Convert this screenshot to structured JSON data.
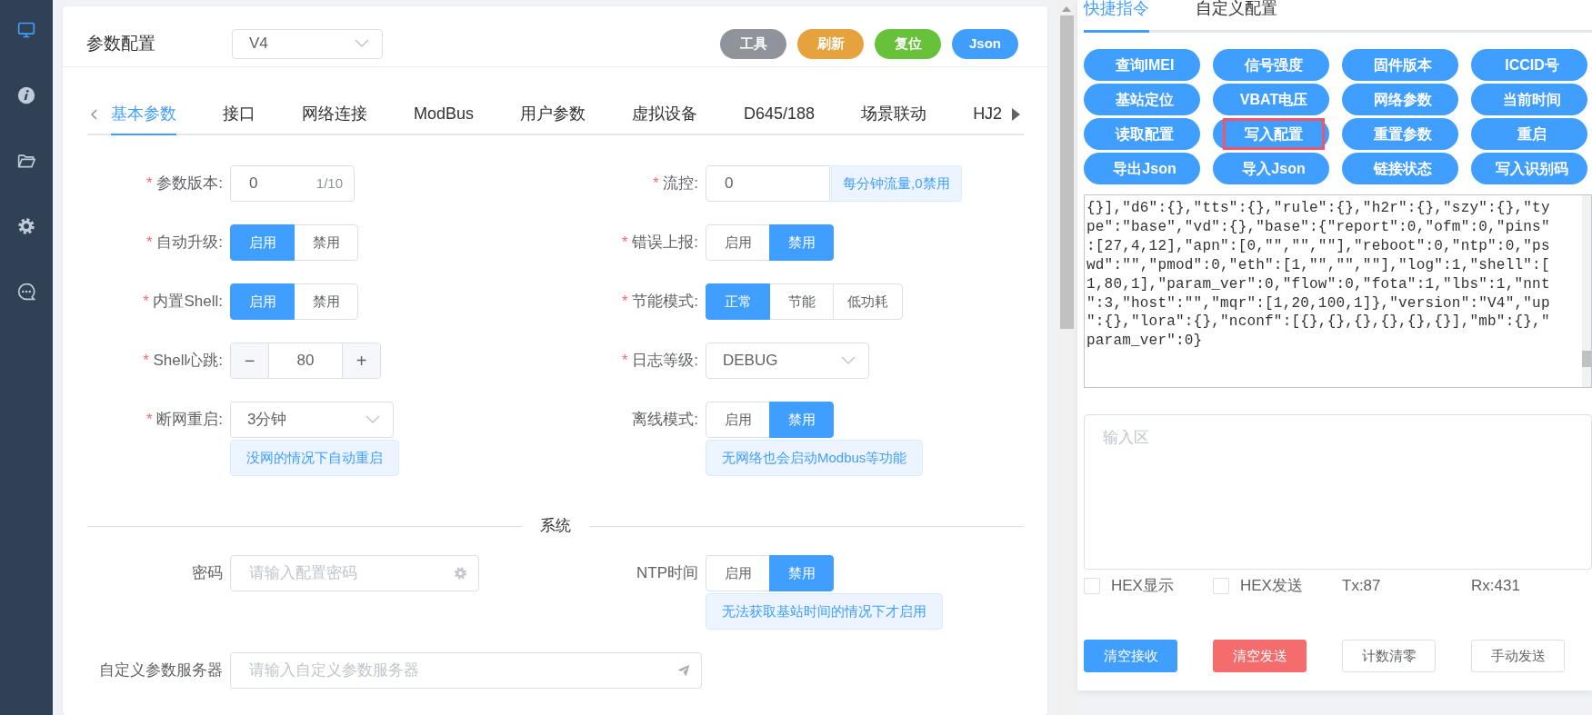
{
  "sidebar": {
    "items": [
      {
        "kind": "monitor",
        "selected": true
      },
      {
        "kind": "info",
        "selected": false
      },
      {
        "kind": "folder",
        "selected": false
      },
      {
        "kind": "gear",
        "selected": false
      },
      {
        "kind": "chat",
        "selected": false
      }
    ]
  },
  "header": {
    "title": "参数配置",
    "version": "V4",
    "buttons": [
      {
        "label": "工具",
        "color": "#909399"
      },
      {
        "label": "刷新",
        "color": "#e6a23c"
      },
      {
        "label": "复位",
        "color": "#67c23a"
      },
      {
        "label": "Json",
        "color": "#409eff"
      }
    ]
  },
  "tabs": [
    {
      "label": "基本参数",
      "selected": true
    },
    {
      "label": "接口",
      "selected": false
    },
    {
      "label": "网络连接",
      "selected": false
    },
    {
      "label": "ModBus",
      "selected": false
    },
    {
      "label": "用户参数",
      "selected": false
    },
    {
      "label": "虚拟设备",
      "selected": false
    },
    {
      "label": "D645/188",
      "selected": false
    },
    {
      "label": "场景联动",
      "selected": false
    },
    {
      "label": "HJ2",
      "selected": false
    }
  ],
  "basic_fields": [
    {
      "label": "参数版本:",
      "required_mark": "*",
      "kind": "input",
      "value": "0",
      "counter": "1/10"
    },
    {
      "label": "流控:",
      "required_mark": "*",
      "kind": "input",
      "value": "0",
      "addon": "每分钟流量,0禁用"
    },
    {
      "label": "自动升级:",
      "required_mark": "*",
      "kind": "toggle",
      "options": [
        {
          "label": "启用",
          "selected": true
        },
        {
          "label": "禁用",
          "selected": false
        }
      ]
    },
    {
      "label": "错误上报:",
      "required_mark": "*",
      "kind": "toggle",
      "options": [
        {
          "label": "启用",
          "selected": false
        },
        {
          "label": "禁用",
          "selected": true
        }
      ]
    },
    {
      "label": "内置Shell:",
      "required_mark": "*",
      "kind": "toggle",
      "options": [
        {
          "label": "启用",
          "selected": true
        },
        {
          "label": "禁用",
          "selected": false
        }
      ]
    },
    {
      "label": "节能模式:",
      "required_mark": "*",
      "kind": "toggle",
      "options": [
        {
          "label": "正常",
          "selected": true
        },
        {
          "label": "节能",
          "selected": false
        },
        {
          "label": "低功耗",
          "selected": false
        }
      ]
    },
    {
      "label": "Shell心跳:",
      "required_mark": "*",
      "kind": "stepper",
      "value": "80",
      "minus": "−",
      "plus": "+"
    },
    {
      "label": "日志等级:",
      "required_mark": "*",
      "kind": "select",
      "value": "DEBUG"
    },
    {
      "label": "断网重启:",
      "required_mark": "*",
      "kind": "select",
      "value": "3分钟",
      "hint": "没网的情况下自动重启"
    },
    {
      "label": "离线模式:",
      "kind": "toggle",
      "options": [
        {
          "label": "启用",
          "selected": false
        },
        {
          "label": "禁用",
          "selected": true
        }
      ],
      "hint": "无网络也会启动Modbus等功能"
    }
  ],
  "system": {
    "title": "系统",
    "fields": [
      {
        "label": "密码",
        "kind": "password_input",
        "placeholder": "请输入配置密码"
      },
      {
        "label": "NTP时间",
        "kind": "toggle",
        "options": [
          {
            "label": "启用",
            "selected": false
          },
          {
            "label": "禁用",
            "selected": true
          }
        ],
        "hint": "无法获取基站时间的情况下才启用"
      },
      {
        "label": "自定义参数服务器",
        "kind": "server_input",
        "placeholder": "请输入自定义参数服务器"
      }
    ]
  },
  "console": {
    "tabs": [
      {
        "label": "快捷指令",
        "selected": true
      },
      {
        "label": "自定义配置",
        "selected": false
      }
    ],
    "commands": [
      {
        "label": "查询IMEI",
        "highlighted": false
      },
      {
        "label": "信号强度",
        "highlighted": false
      },
      {
        "label": "固件版本",
        "highlighted": false
      },
      {
        "label": "ICCID号",
        "highlighted": false
      },
      {
        "label": "基站定位",
        "highlighted": false
      },
      {
        "label": "VBAT电压",
        "highlighted": false
      },
      {
        "label": "网络参数",
        "highlighted": false
      },
      {
        "label": "当前时间",
        "highlighted": false
      },
      {
        "label": "读取配置",
        "highlighted": false
      },
      {
        "label": "写入配置",
        "highlighted": true
      },
      {
        "label": "重置参数",
        "highlighted": false
      },
      {
        "label": "重启",
        "highlighted": false
      },
      {
        "label": "导出Json",
        "highlighted": false
      },
      {
        "label": "导入Json",
        "highlighted": false
      },
      {
        "label": "链接状态",
        "highlighted": false
      },
      {
        "label": "写入识别码",
        "highlighted": false
      }
    ],
    "received": "{}],\"d6\":{},\"tts\":{},\"rule\":{},\"h2r\":{},\"szy\":{},\"type\":\"base\",\"vd\":{},\"base\":{\"report\":0,\"ofm\":0,\"pins\":[27,4,12],\"apn\":[0,\"\",\"\",\"\"],\"reboot\":0,\"ntp\":0,\"pswd\":\"\",\"pmod\":0,\"eth\":[1,\"\",\"\",\"\"],\"log\":1,\"shell\":[1,80,1],\"param_ver\":0,\"flow\":0,\"fota\":1,\"lbs\":1,\"nnt\":3,\"host\":\"\",\"mqr\":[1,20,100,1]},\"version\":\"V4\",\"up\":{},\"lora\":{},\"nconf\":[{},{},{},{},{},{}],\"mb\":{},\"param_ver\":0}",
    "input_placeholder": "输入区",
    "options": [
      {
        "label": "HEX显示",
        "checked": false
      },
      {
        "label": "HEX发送",
        "checked": false
      }
    ],
    "tx": "Tx:87",
    "rx": "Rx:431",
    "actions": [
      {
        "label": "清空接收",
        "kind": "primary"
      },
      {
        "label": "清空发送",
        "kind": "danger"
      },
      {
        "label": "计数清零",
        "kind": "plain"
      },
      {
        "label": "手动发送",
        "kind": "plain"
      }
    ]
  }
}
